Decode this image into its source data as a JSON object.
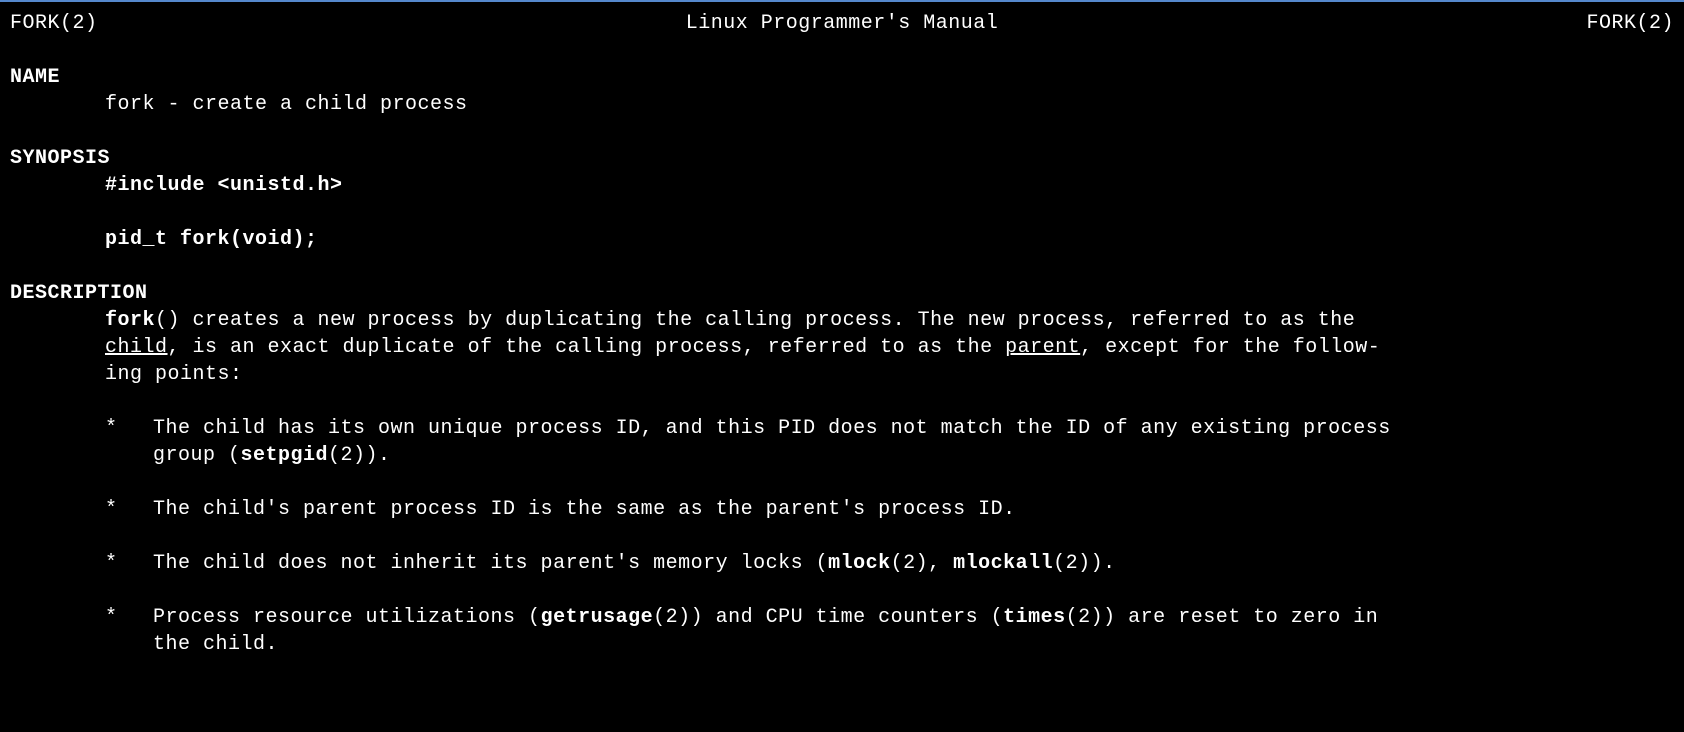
{
  "header": {
    "left": "FORK(2)",
    "center": "Linux Programmer's Manual",
    "right": "FORK(2)"
  },
  "name": {
    "heading": "NAME",
    "text": "fork - create a child process"
  },
  "synopsis": {
    "heading": "SYNOPSIS",
    "include": "#include <unistd.h>",
    "proto": "pid_t fork(void);"
  },
  "description": {
    "heading": "DESCRIPTION",
    "intro": {
      "p1a": "fork",
      "p1b": "()  creates a new process by duplicating the calling process.  The new process, referred to as the",
      "p2a": "child",
      "p2b": ", is an exact duplicate of the calling process, referred to as the ",
      "p2c": "parent",
      "p2d": ", except for the follow-",
      "p3": "ing points:"
    },
    "bullets": [
      {
        "marker": "*",
        "l1a": "The child has its own unique process ID, and this PID does not match the ID of any existing process",
        "l2a": "group (",
        "l2b": "setpgid",
        "l2c": "(2))."
      },
      {
        "marker": "*",
        "l1a": "The child's parent process ID is the same as the parent's process ID."
      },
      {
        "marker": "*",
        "l1a": "The child does not inherit its parent's memory locks (",
        "l1b": "mlock",
        "l1c": "(2), ",
        "l1d": "mlockall",
        "l1e": "(2))."
      },
      {
        "marker": "*",
        "l1a": "Process resource utilizations (",
        "l1b": "getrusage",
        "l1c": "(2)) and CPU time counters (",
        "l1d": "times",
        "l1e": "(2)) are reset to zero  in",
        "l2a": "the child."
      }
    ]
  }
}
